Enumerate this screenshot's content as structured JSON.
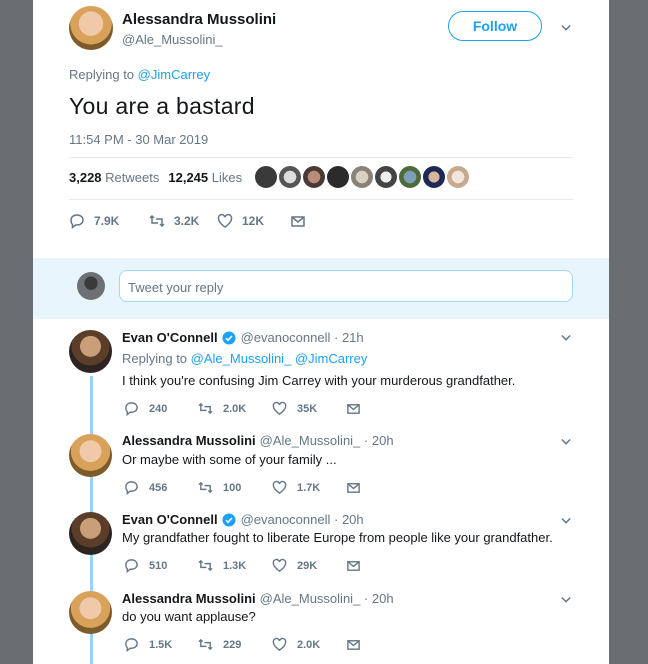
{
  "main_tweet": {
    "author_name": "Alessandra Mussolini",
    "author_handle": "@Ale_Mussolini_",
    "follow_label": "Follow",
    "replying_prefix": "Replying to",
    "replying_to": "@JimCarrey",
    "text": "You are a bastard",
    "timestamp": "11:54 PM - 30 Mar 2019",
    "retweets_count": "3,228",
    "retweets_label": "Retweets",
    "likes_count": "12,245",
    "likes_label": "Likes",
    "actions": {
      "replies": "7.9K",
      "retweets": "3.2K",
      "likes": "12K"
    }
  },
  "reply_box": {
    "placeholder": "Tweet your reply"
  },
  "replies": [
    {
      "name": "Evan O'Connell",
      "handle": "@evanoconnell",
      "time": "· 21h",
      "replying_prefix": "Replying to",
      "replying_to": "@Ale_Mussolini_ @JimCarrey",
      "text": "I think you're confusing Jim Carrey with your murderous grandfather.",
      "replies": "240",
      "retweets": "2.0K",
      "likes": "35K"
    },
    {
      "name": "Alessandra Mussolini",
      "handle": "@Ale_Mussolini_",
      "time": "· 20h",
      "text": "Or maybe with some of your family ...",
      "replies": "456",
      "retweets": "100",
      "likes": "1.7K"
    },
    {
      "name": "Evan O'Connell",
      "handle": "@evanoconnell",
      "time": "· 20h",
      "text": "My grandfather fought to liberate Europe from people like your grandfather.",
      "replies": "510",
      "retweets": "1.3K",
      "likes": "29K"
    },
    {
      "name": "Alessandra Mussolini",
      "handle": "@Ale_Mussolini_",
      "time": "· 20h",
      "text": "do you want applause?",
      "replies": "1.5K",
      "retweets": "229",
      "likes": "2.0K"
    }
  ],
  "colors": {
    "accent": "#1da1f2",
    "muted": "#657786",
    "thread": "#9bd3f7",
    "backdrop": "#6b6e70"
  }
}
